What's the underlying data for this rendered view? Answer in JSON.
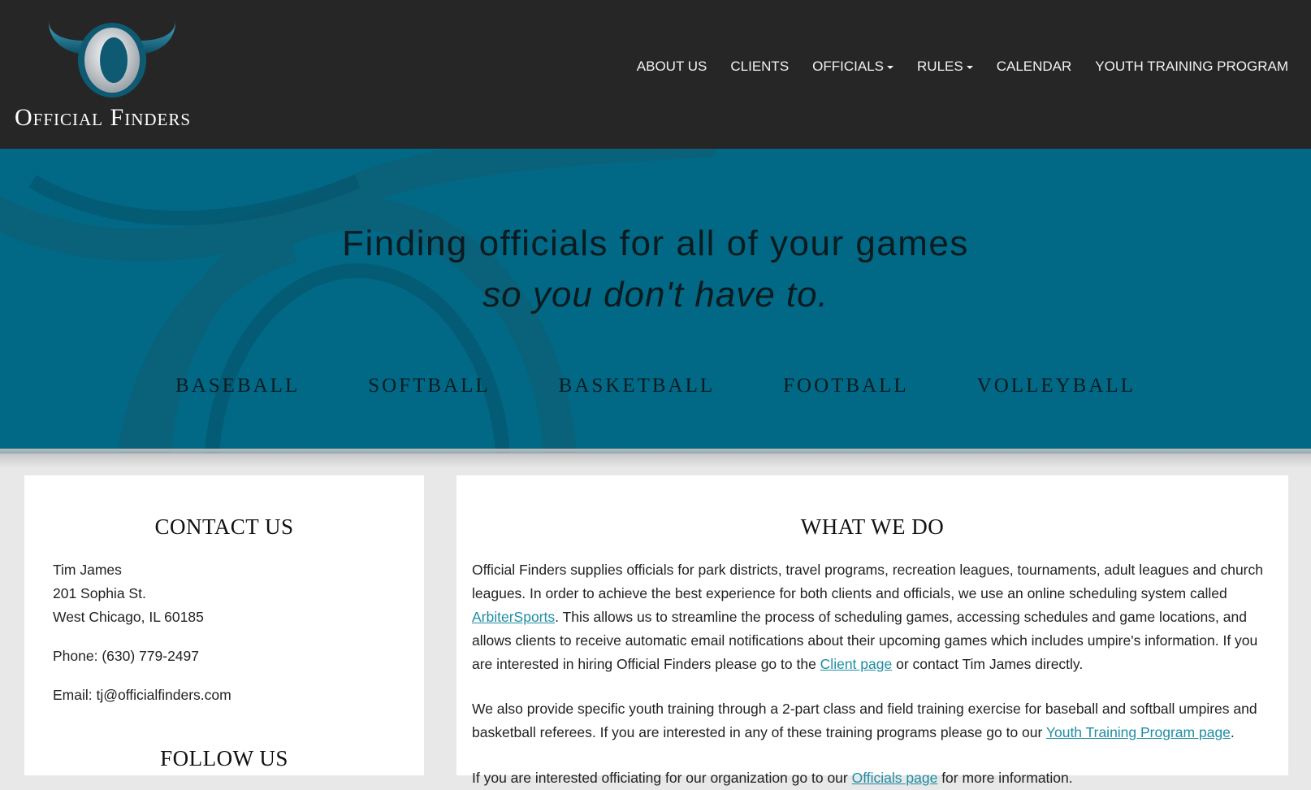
{
  "header": {
    "logo_text": "Official Finders",
    "nav": [
      {
        "label": "ABOUT US",
        "has_dropdown": false
      },
      {
        "label": "CLIENTS",
        "has_dropdown": false
      },
      {
        "label": "OFFICIALS",
        "has_dropdown": true
      },
      {
        "label": "RULES",
        "has_dropdown": true
      },
      {
        "label": "CALENDAR",
        "has_dropdown": false
      },
      {
        "label": "YOUTH TRAINING PROGRAM",
        "has_dropdown": false
      }
    ]
  },
  "hero": {
    "title": "Finding officials for all of your games",
    "subtitle": "so you don't have to.",
    "sports": [
      "BASEBALL",
      "SOFTBALL",
      "BASKETBALL",
      "FOOTBALL",
      "VOLLEYBALL"
    ]
  },
  "contact": {
    "heading": "CONTACT US",
    "name": "Tim James",
    "street": "201 Sophia St.",
    "city": "West Chicago, IL 60185",
    "phone": "Phone: (630) 779-2497",
    "email": "Email: tj@officialfinders.com",
    "follow_heading": "FOLLOW US"
  },
  "what_we_do": {
    "heading": "WHAT WE DO",
    "p1_a": "Official Finders supplies officials for park districts, travel programs, recreation leagues, tournaments, adult leagues and church leagues. In order to achieve the best experience for both clients and officials, we use an online scheduling system called ",
    "p1_link1": "ArbiterSports",
    "p1_b": ". This allows us to streamline the process of scheduling games, accessing schedules and game locations, and allows clients to receive automatic email notifications about their upcoming games which includes umpire's information. If you are interested in hiring Official Finders please go to the ",
    "p1_link2": "Client page",
    "p1_c": " or contact Tim James directly.",
    "p2_a": "We also provide specific youth training through a 2-part class and field training exercise for baseball and softball umpires and basketball referees. If you are interested in any of these training programs please go to our ",
    "p2_link": "Youth Training Program page",
    "p2_b": ".",
    "p3_a": "If you are interested officiating for our organization go to our ",
    "p3_link": "Officials page",
    "p3_b": " for more information."
  },
  "colors": {
    "topbar": "#262626",
    "hero": "#016985",
    "link": "#1f8da3",
    "page_bg": "#e8e8e8"
  }
}
